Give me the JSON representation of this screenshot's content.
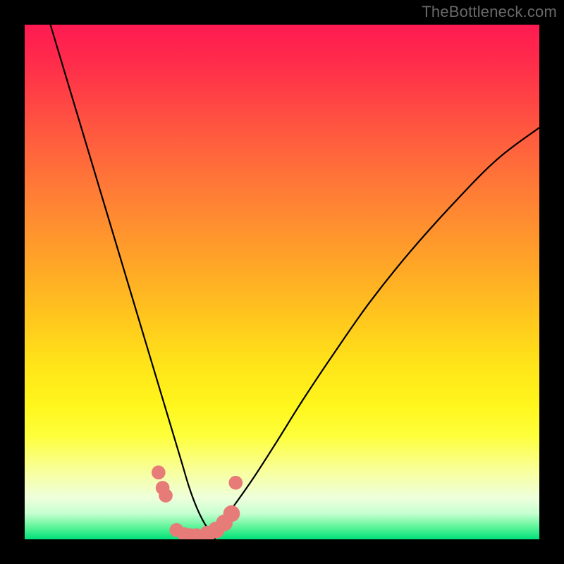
{
  "watermark": "TheBottleneck.com",
  "colors": {
    "frame": "#000000",
    "curve": "#000000",
    "marker": "#e77b78",
    "watermark_text": "#6a6a6a"
  },
  "chart_data": {
    "type": "line",
    "title": "",
    "xlabel": "",
    "ylabel": "",
    "xlim": [
      0,
      100
    ],
    "ylim": [
      0,
      100
    ],
    "series": [
      {
        "name": "left-curve",
        "x": [
          5,
          8,
          11,
          14,
          17,
          20,
          23,
          26,
          27.5,
          29,
          30.5,
          32,
          33.5,
          35,
          37
        ],
        "y": [
          100,
          90,
          80,
          70,
          60,
          50,
          40,
          30,
          25,
          20,
          15,
          10,
          6,
          3,
          0
        ]
      },
      {
        "name": "right-curve",
        "x": [
          35,
          38,
          41,
          44.5,
          49,
          54,
          60,
          67,
          75,
          84,
          92,
          100
        ],
        "y": [
          0,
          3,
          7,
          12,
          19,
          27,
          36,
          46,
          56,
          66,
          74,
          80
        ]
      }
    ],
    "markers": {
      "name": "highlighted-points",
      "points": [
        {
          "x": 26.0,
          "y": 13.0,
          "r": 1.5
        },
        {
          "x": 26.8,
          "y": 10.0,
          "r": 1.5
        },
        {
          "x": 27.4,
          "y": 8.5,
          "r": 1.5
        },
        {
          "x": 29.5,
          "y": 1.8,
          "r": 1.5
        },
        {
          "x": 31.0,
          "y": 1.0,
          "r": 1.5
        },
        {
          "x": 32.2,
          "y": 0.8,
          "r": 1.5
        },
        {
          "x": 33.4,
          "y": 0.8,
          "r": 1.5
        },
        {
          "x": 35.5,
          "y": 1.0,
          "r": 1.8
        },
        {
          "x": 37.2,
          "y": 1.8,
          "r": 1.8
        },
        {
          "x": 38.8,
          "y": 3.2,
          "r": 1.8
        },
        {
          "x": 40.2,
          "y": 5.0,
          "r": 1.8
        },
        {
          "x": 41.0,
          "y": 11.0,
          "r": 1.5
        }
      ]
    }
  }
}
